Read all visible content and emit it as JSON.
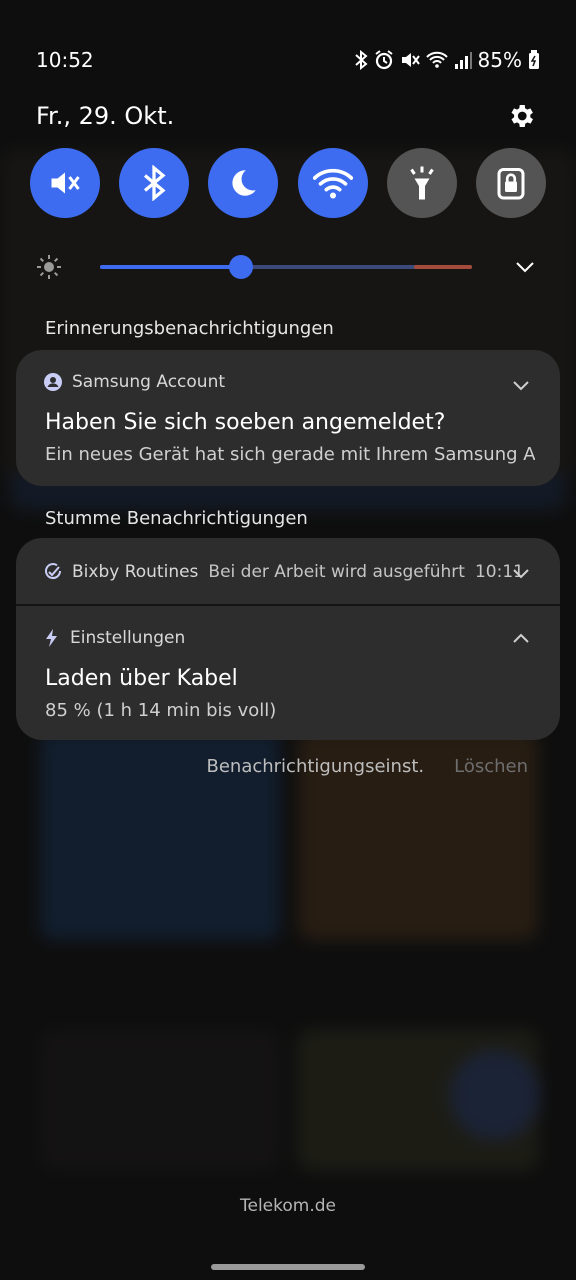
{
  "status_bar": {
    "time": "10:52",
    "battery": "85%",
    "icons": [
      "bluetooth-icon",
      "alarm-icon",
      "mute-icon",
      "wifi-icon",
      "signal-icon",
      "battery-icon"
    ]
  },
  "header": {
    "date": "Fr., 29. Okt.",
    "settings_icon": "gear-icon"
  },
  "quick_settings": [
    {
      "name": "mute",
      "icon": "mute-icon",
      "active": true
    },
    {
      "name": "bluetooth",
      "icon": "bluetooth-icon",
      "active": true
    },
    {
      "name": "night-mode",
      "icon": "moon-icon",
      "active": true
    },
    {
      "name": "wifi",
      "icon": "wifi-icon",
      "active": true
    },
    {
      "name": "flashlight",
      "icon": "flashlight-icon",
      "active": false
    },
    {
      "name": "secure-folder",
      "icon": "lock-icon",
      "active": false
    }
  ],
  "brightness": {
    "level": 0.38
  },
  "sections": {
    "reminders": "Erinnerungsbenachrichtigungen",
    "silent": "Stumme Benachrichtigungen"
  },
  "notifications": {
    "samsung": {
      "app": "Samsung Account",
      "title": "Haben Sie sich soeben angemeldet?",
      "body": "Ein neues Gerät hat sich gerade mit Ihrem Samsung Acc.."
    },
    "bixby": {
      "app": "Bixby Routines",
      "text": "Bei der Arbeit wird ausgeführt",
      "time": "10:11"
    },
    "settings": {
      "app": "Einstellungen",
      "title": "Laden über Kabel",
      "body": "85 % (1 h 14 min bis voll)"
    }
  },
  "actions": {
    "settings": "Benachrichtigungseinst.",
    "clear": "Löschen"
  },
  "carrier": "Telekom.de",
  "colors": {
    "accent": "#3d6cf0",
    "card": "#2d2d2d",
    "tile_off": "#545454"
  }
}
